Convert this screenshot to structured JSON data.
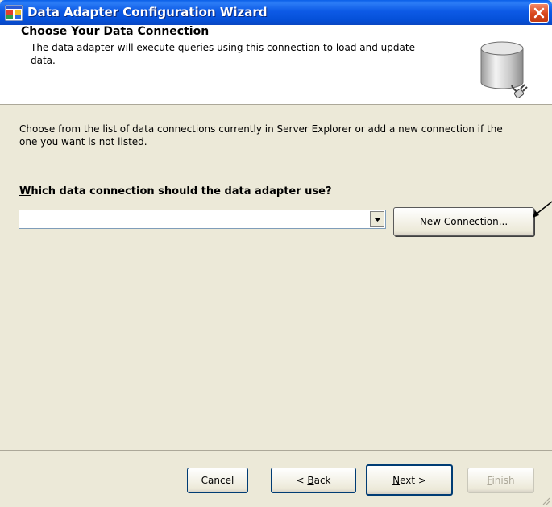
{
  "window": {
    "title": "Data Adapter Configuration Wizard",
    "icon": "wizard-app-icon",
    "close_icon": "close-icon"
  },
  "header": {
    "title": "Choose Your Data Connection",
    "description": "The data adapter will execute queries using this connection to load and update data.",
    "icon": "database-plug-icon"
  },
  "body": {
    "instructions": "Choose from the list of data connections currently in Server Explorer or add a new connection if the one you want is not listed.",
    "question_mnemonic": "W",
    "question_rest": "hich data connection should the data adapter use?",
    "connection_value": "",
    "new_connection_pre": "New ",
    "new_connection_mnemonic": "C",
    "new_connection_post": "onnection..."
  },
  "footer": {
    "cancel_label": "Cancel",
    "back_pre": "< ",
    "back_mnemonic": "B",
    "back_post": "ack",
    "next_mnemonic": "N",
    "next_post": "ext >",
    "finish_mnemonic": "F",
    "finish_post": "inish",
    "finish_enabled": false
  }
}
